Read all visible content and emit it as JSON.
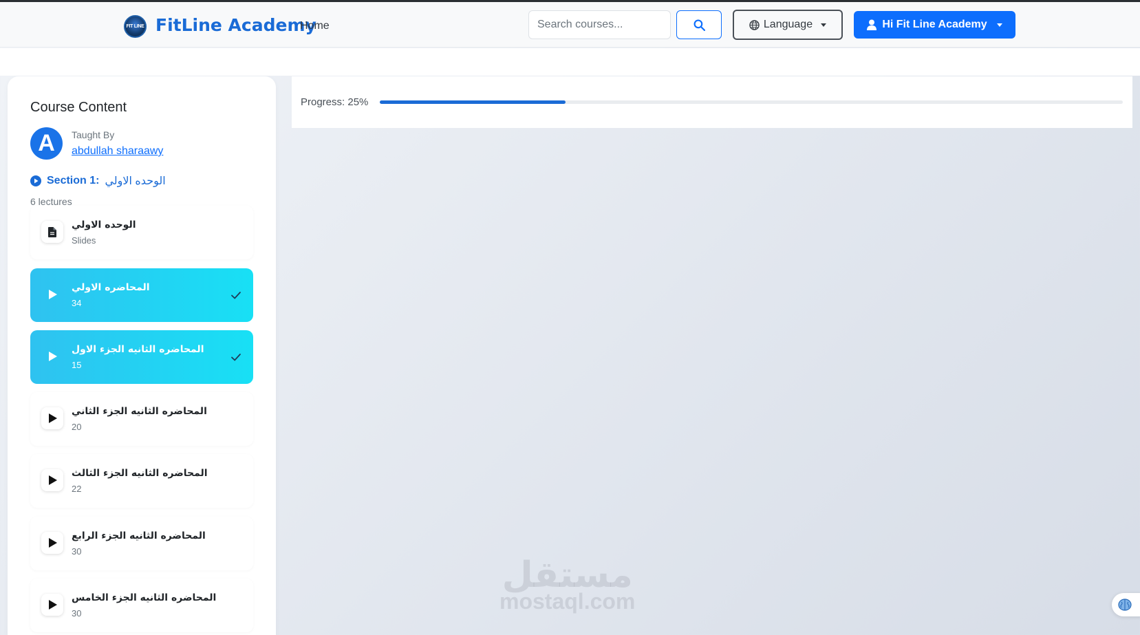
{
  "navbar": {
    "logo_text": "FIT LINE",
    "brand": "FitLine Academy",
    "home": "Home",
    "search_placeholder": "Search courses...",
    "language": "Language",
    "user_greeting": "Hi Fit Line Academy"
  },
  "sidebar": {
    "title": "Course Content",
    "avatar_letter": "A",
    "taught_by": "Taught By",
    "teacher": "abdullah sharaawy",
    "section_number": "Section 1:",
    "section_name": "الوحده الاولي",
    "lecture_count": "6 lectures",
    "lectures": [
      {
        "title": "الوحده الاولي",
        "sub": "Slides",
        "type": "document",
        "completed": false
      },
      {
        "title": "المحاضره الاولي",
        "sub": "34",
        "type": "video",
        "completed": true
      },
      {
        "title": "المحاضره الثانيه الجزء الاول",
        "sub": "15",
        "type": "video",
        "completed": true
      },
      {
        "title": "المحاضره الثانيه الجزء الثاني",
        "sub": "20",
        "type": "video",
        "completed": false
      },
      {
        "title": "المحاضره الثانيه الجزء الثالث",
        "sub": "22",
        "type": "video",
        "completed": false
      },
      {
        "title": "المحاضره الثانيه الجزء الرابع",
        "sub": "30",
        "type": "video",
        "completed": false
      },
      {
        "title": "المحاضره الثانيه الجزء الخامس",
        "sub": "30",
        "type": "video",
        "completed": false
      }
    ]
  },
  "progress": {
    "label": "Progress: 25%",
    "value_percent": 25
  },
  "watermark": {
    "arabic": "مستقل",
    "latin": "mostaql.com"
  },
  "colors": {
    "brand": "#1a6bd6",
    "primary": "#0d6efd",
    "completed_gradient_start": "#2fc2f0",
    "completed_gradient_end": "#18e0f5"
  },
  "icons": {
    "search": "search-icon",
    "language": "globe-icon",
    "user": "user-icon",
    "section": "play-circle-icon",
    "document": "file-icon",
    "video": "play-icon",
    "completed": "check-icon",
    "widget": "brain-icon"
  }
}
